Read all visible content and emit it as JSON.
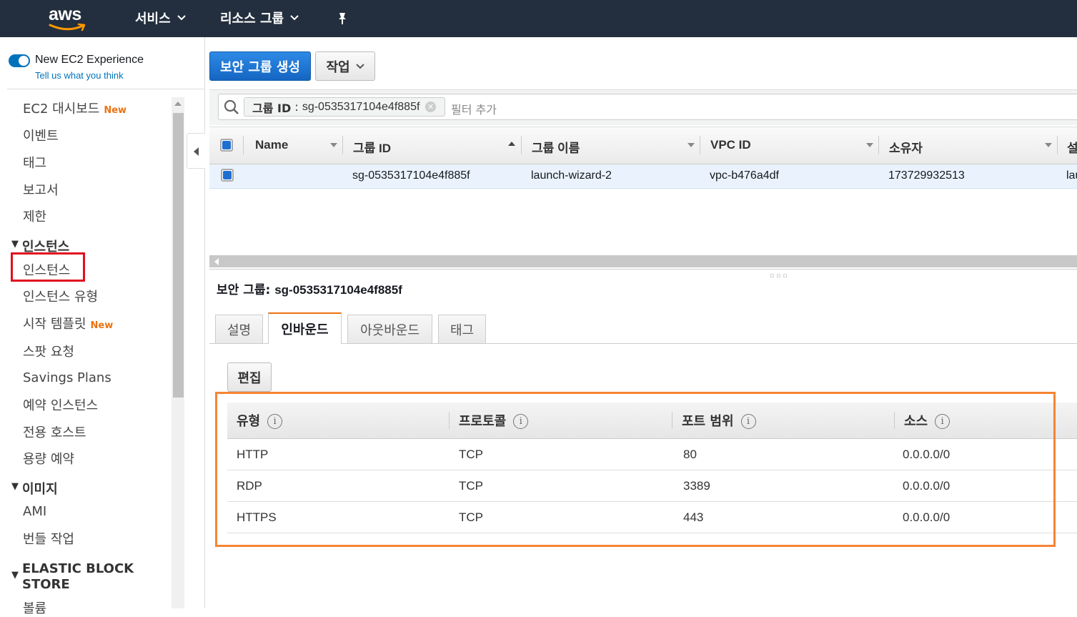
{
  "topnav": {
    "logo": "aws",
    "services": "서비스",
    "resource_groups": "리소스 그룹"
  },
  "sidebar": {
    "experience_title": "New EC2 Experience",
    "experience_link": "Tell us what you think",
    "items": [
      {
        "label": "EC2 대시보드",
        "badge": "New"
      },
      {
        "label": "이벤트"
      },
      {
        "label": "태그"
      },
      {
        "label": "보고서"
      },
      {
        "label": "제한"
      }
    ],
    "section_instances": "인스턴스",
    "instances_items": [
      {
        "label": "인스턴스"
      },
      {
        "label": "인스턴스 유형"
      },
      {
        "label": "시작 템플릿",
        "badge": "New"
      },
      {
        "label": "스팟 요청"
      },
      {
        "label": "Savings Plans"
      },
      {
        "label": "예약 인스턴스"
      },
      {
        "label": "전용 호스트"
      },
      {
        "label": "용량 예약"
      }
    ],
    "section_images": "이미지",
    "images_items": [
      {
        "label": "AMI"
      },
      {
        "label": "번들 작업"
      }
    ],
    "section_ebs_line1": "ELASTIC BLOCK",
    "section_ebs_line2": "STORE",
    "ebs_items": [
      {
        "label": "볼륨"
      }
    ]
  },
  "toolbar": {
    "create_button": "보안 그룹 생성",
    "actions_button": "작업"
  },
  "filter": {
    "token_key": "그룹 ID",
    "token_sep": " : ",
    "token_value": "sg-0535317104e4f885f",
    "placeholder": "필터 추가"
  },
  "table": {
    "columns": [
      "Name",
      "그룹 ID",
      "그룹 이름",
      "VPC ID",
      "소유자",
      "설"
    ],
    "rows": [
      {
        "name": "",
        "group_id": "sg-0535317104e4f885f",
        "group_name": "launch-wizard-2",
        "vpc_id": "vpc-b476a4df",
        "owner": "173729932513",
        "desc": "lau"
      }
    ]
  },
  "detail": {
    "title_label": "보안 그룹: ",
    "title_value": "sg-0535317104e4f885f",
    "tabs": [
      "설명",
      "인바운드",
      "아웃바운드",
      "태그"
    ],
    "active_tab": "인바운드",
    "edit_button": "편집",
    "rules_columns": [
      "유형",
      "프로토콜",
      "포트 범위",
      "소스"
    ],
    "rules": [
      {
        "type": "HTTP",
        "protocol": "TCP",
        "port": "80",
        "source": "0.0.0.0/0"
      },
      {
        "type": "RDP",
        "protocol": "TCP",
        "port": "3389",
        "source": "0.0.0.0/0"
      },
      {
        "type": "HTTPS",
        "protocol": "TCP",
        "port": "443",
        "source": "0.0.0.0/0"
      }
    ]
  },
  "colors": {
    "nav_bg": "#232f3e",
    "primary": "#1d76d2",
    "accent_orange": "#f58534",
    "highlight_red": "#e0101f",
    "new_badge": "#ec7211"
  }
}
